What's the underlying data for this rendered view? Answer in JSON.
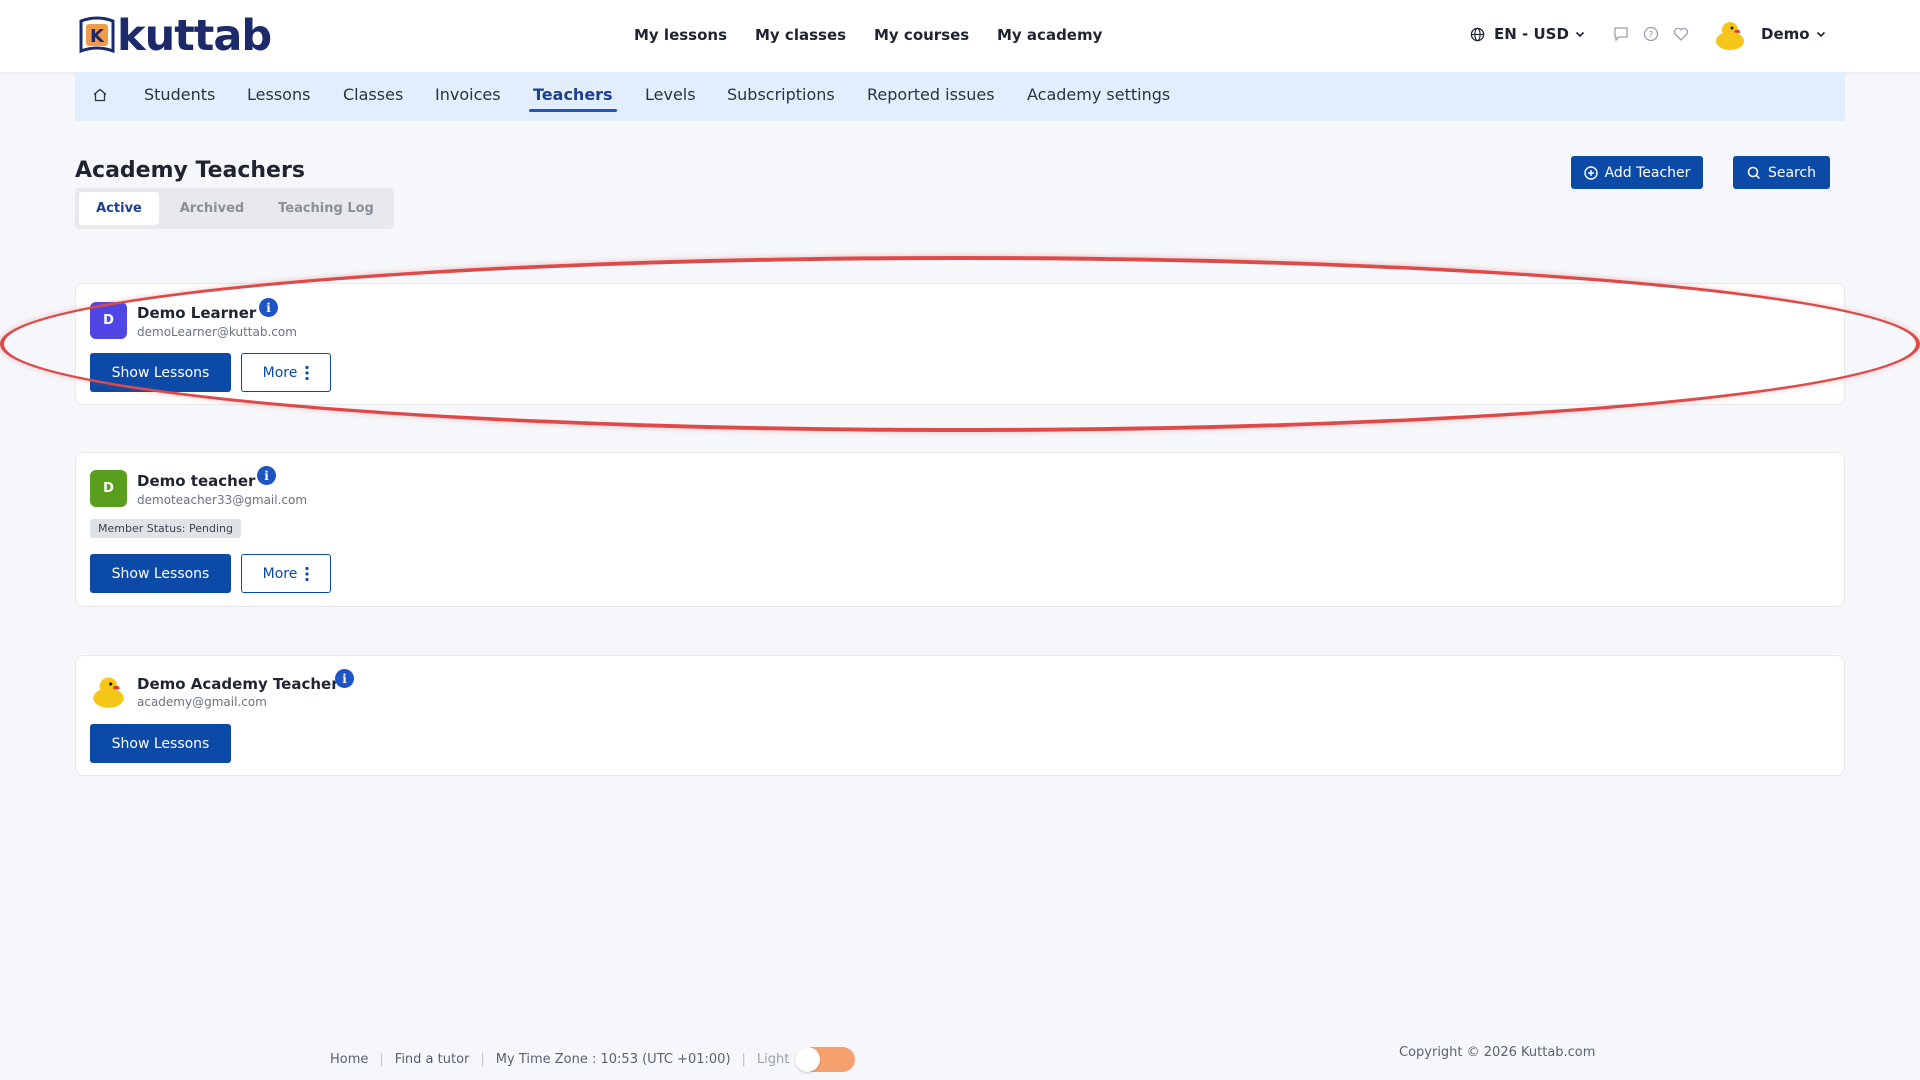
{
  "brand": {
    "name": "kuttab",
    "badge_letter": "K"
  },
  "header": {
    "nav": [
      "My lessons",
      "My classes",
      "My courses",
      "My academy"
    ],
    "lang": "EN - USD",
    "user": "Demo"
  },
  "subnav": {
    "items": [
      "Students",
      "Lessons",
      "Classes",
      "Invoices",
      "Teachers",
      "Levels",
      "Subscriptions",
      "Reported issues",
      "Academy settings"
    ],
    "active": "Teachers"
  },
  "page": {
    "title": "Academy Teachers",
    "tabs": [
      "Active",
      "Archived",
      "Teaching Log"
    ],
    "add_label": "Add Teacher",
    "search_label": "Search"
  },
  "teachers": [
    {
      "initial": "D",
      "name": "Demo Learner",
      "email": "demoLearner@kuttab.com",
      "avatar_color": "#4f46e5",
      "status": "",
      "show_label": "Show Lessons",
      "more_label": "More"
    },
    {
      "initial": "D",
      "name": "Demo teacher",
      "email": "demoteacher33@gmail.com",
      "avatar_color": "#5a9e1e",
      "status": "Member Status: Pending",
      "show_label": "Show Lessons",
      "more_label": "More"
    },
    {
      "initial": "",
      "name": "Demo Academy Teacher",
      "email": "academy@gmail.com",
      "avatar_color": "#ffffff",
      "status": "",
      "show_label": "Show Lessons",
      "more_label": ""
    }
  ],
  "footer": {
    "home": "Home",
    "find": "Find a tutor",
    "timezone": "My Time Zone : 10:53 (UTC +01:00)",
    "theme": "Light",
    "copyright": "Copyright © 2026 Kuttab.com"
  },
  "colors": {
    "primary": "#0b4aa6",
    "accent_orange": "#f7a070",
    "highlight": "#de4a4a",
    "subnav_bg": "#e3eefc"
  }
}
